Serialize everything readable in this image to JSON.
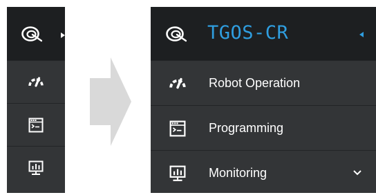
{
  "app": {
    "title": "TGOS-CR"
  },
  "sidebar": {
    "items": [
      {
        "label": "Robot Operation",
        "icon": "gauge-icon"
      },
      {
        "label": "Programming",
        "icon": "terminal-window-icon"
      },
      {
        "label": "Monitoring",
        "icon": "monitor-chart-icon",
        "has_submenu": true
      }
    ]
  },
  "colors": {
    "header_bg": "#1d1f21",
    "menu_bg": "#333537",
    "accent": "#2f9ee0",
    "text": "#ffffff",
    "arrow": "#d9d9d9"
  }
}
